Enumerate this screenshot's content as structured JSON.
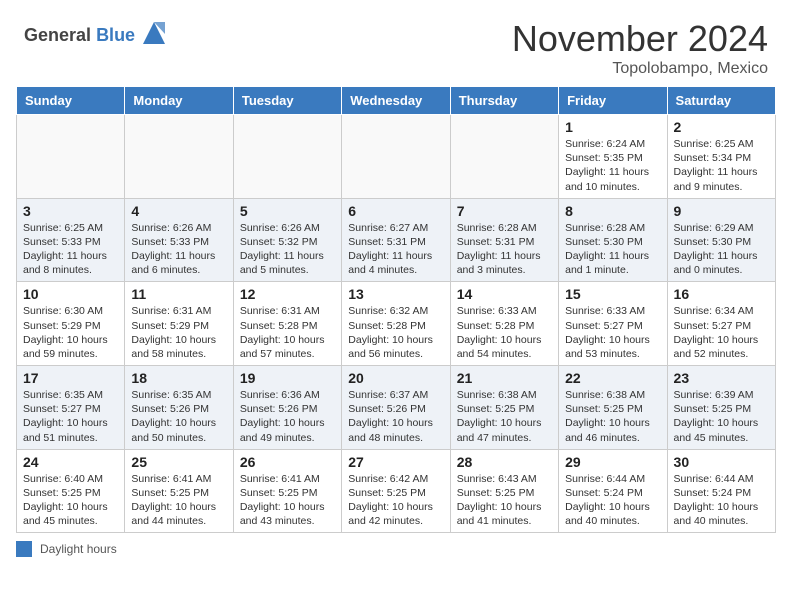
{
  "header": {
    "logo_line1": "General",
    "logo_line2": "Blue",
    "month_title": "November 2024",
    "location": "Topolobampo, Mexico"
  },
  "days_of_week": [
    "Sunday",
    "Monday",
    "Tuesday",
    "Wednesday",
    "Thursday",
    "Friday",
    "Saturday"
  ],
  "legend": {
    "label": "Daylight hours"
  },
  "weeks": [
    [
      {
        "day": "",
        "info": ""
      },
      {
        "day": "",
        "info": ""
      },
      {
        "day": "",
        "info": ""
      },
      {
        "day": "",
        "info": ""
      },
      {
        "day": "",
        "info": ""
      },
      {
        "day": "1",
        "info": "Sunrise: 6:24 AM\nSunset: 5:35 PM\nDaylight: 11 hours and 10 minutes."
      },
      {
        "day": "2",
        "info": "Sunrise: 6:25 AM\nSunset: 5:34 PM\nDaylight: 11 hours and 9 minutes."
      }
    ],
    [
      {
        "day": "3",
        "info": "Sunrise: 6:25 AM\nSunset: 5:33 PM\nDaylight: 11 hours and 8 minutes."
      },
      {
        "day": "4",
        "info": "Sunrise: 6:26 AM\nSunset: 5:33 PM\nDaylight: 11 hours and 6 minutes."
      },
      {
        "day": "5",
        "info": "Sunrise: 6:26 AM\nSunset: 5:32 PM\nDaylight: 11 hours and 5 minutes."
      },
      {
        "day": "6",
        "info": "Sunrise: 6:27 AM\nSunset: 5:31 PM\nDaylight: 11 hours and 4 minutes."
      },
      {
        "day": "7",
        "info": "Sunrise: 6:28 AM\nSunset: 5:31 PM\nDaylight: 11 hours and 3 minutes."
      },
      {
        "day": "8",
        "info": "Sunrise: 6:28 AM\nSunset: 5:30 PM\nDaylight: 11 hours and 1 minute."
      },
      {
        "day": "9",
        "info": "Sunrise: 6:29 AM\nSunset: 5:30 PM\nDaylight: 11 hours and 0 minutes."
      }
    ],
    [
      {
        "day": "10",
        "info": "Sunrise: 6:30 AM\nSunset: 5:29 PM\nDaylight: 10 hours and 59 minutes."
      },
      {
        "day": "11",
        "info": "Sunrise: 6:31 AM\nSunset: 5:29 PM\nDaylight: 10 hours and 58 minutes."
      },
      {
        "day": "12",
        "info": "Sunrise: 6:31 AM\nSunset: 5:28 PM\nDaylight: 10 hours and 57 minutes."
      },
      {
        "day": "13",
        "info": "Sunrise: 6:32 AM\nSunset: 5:28 PM\nDaylight: 10 hours and 56 minutes."
      },
      {
        "day": "14",
        "info": "Sunrise: 6:33 AM\nSunset: 5:28 PM\nDaylight: 10 hours and 54 minutes."
      },
      {
        "day": "15",
        "info": "Sunrise: 6:33 AM\nSunset: 5:27 PM\nDaylight: 10 hours and 53 minutes."
      },
      {
        "day": "16",
        "info": "Sunrise: 6:34 AM\nSunset: 5:27 PM\nDaylight: 10 hours and 52 minutes."
      }
    ],
    [
      {
        "day": "17",
        "info": "Sunrise: 6:35 AM\nSunset: 5:27 PM\nDaylight: 10 hours and 51 minutes."
      },
      {
        "day": "18",
        "info": "Sunrise: 6:35 AM\nSunset: 5:26 PM\nDaylight: 10 hours and 50 minutes."
      },
      {
        "day": "19",
        "info": "Sunrise: 6:36 AM\nSunset: 5:26 PM\nDaylight: 10 hours and 49 minutes."
      },
      {
        "day": "20",
        "info": "Sunrise: 6:37 AM\nSunset: 5:26 PM\nDaylight: 10 hours and 48 minutes."
      },
      {
        "day": "21",
        "info": "Sunrise: 6:38 AM\nSunset: 5:25 PM\nDaylight: 10 hours and 47 minutes."
      },
      {
        "day": "22",
        "info": "Sunrise: 6:38 AM\nSunset: 5:25 PM\nDaylight: 10 hours and 46 minutes."
      },
      {
        "day": "23",
        "info": "Sunrise: 6:39 AM\nSunset: 5:25 PM\nDaylight: 10 hours and 45 minutes."
      }
    ],
    [
      {
        "day": "24",
        "info": "Sunrise: 6:40 AM\nSunset: 5:25 PM\nDaylight: 10 hours and 45 minutes."
      },
      {
        "day": "25",
        "info": "Sunrise: 6:41 AM\nSunset: 5:25 PM\nDaylight: 10 hours and 44 minutes."
      },
      {
        "day": "26",
        "info": "Sunrise: 6:41 AM\nSunset: 5:25 PM\nDaylight: 10 hours and 43 minutes."
      },
      {
        "day": "27",
        "info": "Sunrise: 6:42 AM\nSunset: 5:25 PM\nDaylight: 10 hours and 42 minutes."
      },
      {
        "day": "28",
        "info": "Sunrise: 6:43 AM\nSunset: 5:25 PM\nDaylight: 10 hours and 41 minutes."
      },
      {
        "day": "29",
        "info": "Sunrise: 6:44 AM\nSunset: 5:24 PM\nDaylight: 10 hours and 40 minutes."
      },
      {
        "day": "30",
        "info": "Sunrise: 6:44 AM\nSunset: 5:24 PM\nDaylight: 10 hours and 40 minutes."
      }
    ]
  ]
}
